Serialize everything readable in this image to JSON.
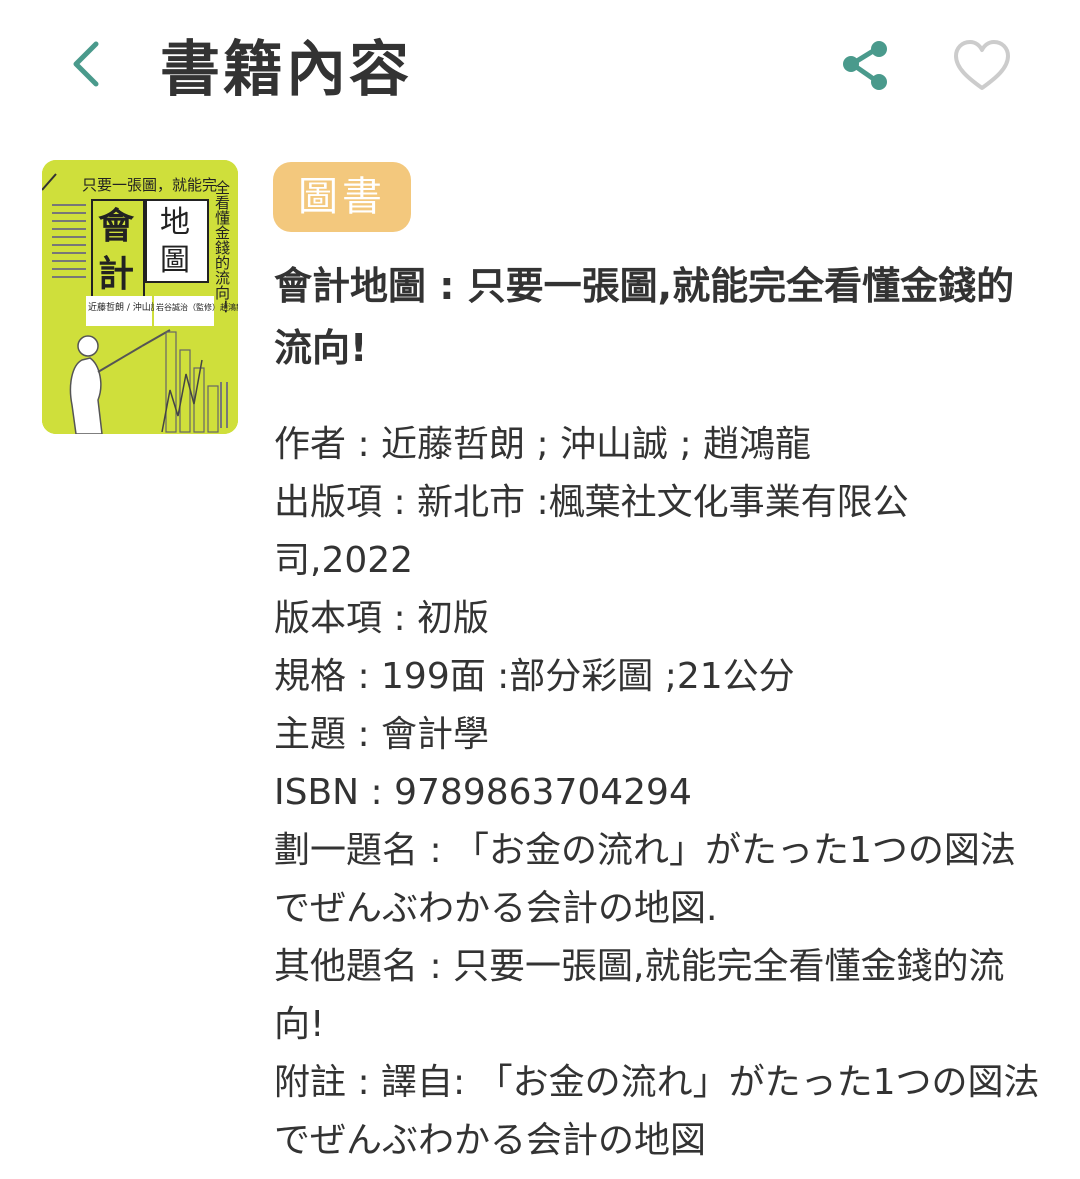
{
  "header": {
    "title": "書籍內容",
    "back_icon": "chevron-left-icon",
    "share_icon": "share-icon",
    "favorite_icon": "heart-outline-icon"
  },
  "colors": {
    "accent": "#4a9a8c",
    "badge": "#f3c87d",
    "heart": "#cccccc",
    "cover": "#cfdf3b"
  },
  "cover": {
    "tagline_h": "只要一張圖，就能完",
    "tagline_v": "全看懂金錢的流向！",
    "title_left_1": "會",
    "title_left_2": "計",
    "title_right_1": "地",
    "title_right_2": "圖",
    "authors": "近藤哲朗 / 沖山誠（著）",
    "supervisor": "岩谷誠治（監修）趙鴻龍（譯）"
  },
  "book": {
    "type_badge": "圖書",
    "title": "會計地圖 : 只要一張圖,就能完全看懂金錢的流向!",
    "details": [
      "作者 : 近藤哲朗 ; 沖山誠 ; 趙鴻龍",
      "出版項 : 新北市 :楓葉社文化事業有限公司,2022",
      "版本項 : 初版",
      "規格 : 199面 :部分彩圖 ;21公分",
      "主題 : 會計學",
      "ISBN : 9789863704294",
      "劃一題名 : 「お金の流れ」がたった1つの図法でぜんぶわかる会計の地図.",
      "其他題名 : 只要一張圖,就能完全看懂金錢的流向!",
      "附註 : 譯自: 「お金の流れ」がたった1つの図法でぜんぶわかる会計の地図"
    ]
  }
}
